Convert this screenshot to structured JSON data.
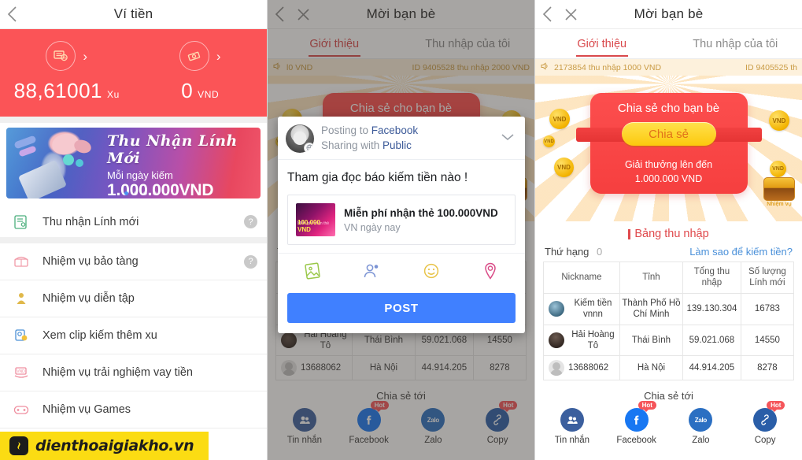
{
  "left": {
    "topbar": {
      "title": "Ví tiền",
      "back_icon": "chevron-left-icon"
    },
    "wallet": {
      "coin": {
        "amount": "88,61001",
        "unit": "Xu",
        "icon": "coin-stack-icon"
      },
      "cash": {
        "amount": "0",
        "unit": "VND",
        "icon": "money-note-icon"
      }
    },
    "banner": {
      "headline": "Thu Nhận Lính Mới",
      "subline": "Mỗi ngày kiếm",
      "amount": "1.000.000VND",
      "dots": 4,
      "active_dot": 0
    },
    "menu": [
      {
        "label": "Thu nhận Lính mới",
        "icon": "document-person-icon",
        "help": "?"
      },
      {
        "label": "Nhiệm vụ bảo tàng",
        "icon": "treasure-chest-icon",
        "help": "?"
      },
      {
        "label": "Nhiệm vụ diễn tập",
        "icon": "statue-icon",
        "help": ""
      },
      {
        "label": "Xem clip kiếm thêm xu",
        "icon": "video-coin-icon",
        "help": ""
      },
      {
        "label": "Nhiệm vụ trải nghiệm vay tiền",
        "icon": "hand-money-icon",
        "help": ""
      },
      {
        "label": "Nhiệm vụ Games",
        "icon": "gamepad-icon",
        "help": ""
      }
    ],
    "watermark": {
      "text": "dienthoaigiakho.vn",
      "logo_icon": "app-logo-icon"
    }
  },
  "invite": {
    "topbar": {
      "title": "Mời bạn bè",
      "back_icon": "chevron-left-icon",
      "close_icon": "close-icon"
    },
    "tabs": [
      {
        "label": "Giới thiệu",
        "active": true
      },
      {
        "label": "Thu nhập của tôi",
        "active": false
      }
    ],
    "marquee_mid": {
      "icon": "speaker-icon",
      "left": "l0 VND",
      "right": "ID 9405528 thu nhập 2000 VND"
    },
    "marquee_right": {
      "icon": "speaker-icon",
      "left": "2173854 thu nhập 1000 VND",
      "right": "ID 9405525 th"
    },
    "hero": {
      "card_title": "Chia sẻ cho bạn bè",
      "button_label": "Chia sẻ",
      "reward_line1": "Giải thưởng lên đến",
      "reward_line2": "1.000.000 VND",
      "coin_label": "VND",
      "chest_label": "Nhiệm vụ"
    },
    "board": {
      "title": "Bảng thu nhập",
      "rank_label": "Thứ hạng",
      "rank_value": "0",
      "help_link": "Làm sao để kiếm tiền?",
      "columns": [
        "Nickname",
        "Tỉnh",
        "Tổng thu nhập",
        "Số lượng Lính mới"
      ],
      "rows": [
        {
          "avatar": "a1",
          "nickname": "Kiếm tiền vnnn",
          "province": "Thành Phố Hồ Chí Minh",
          "income": "139.130.304",
          "recruits": "16783"
        },
        {
          "avatar": "a2",
          "nickname": "Hải Hoàng Tô",
          "province": "Thái Bình",
          "income": "59.021.068",
          "recruits": "14550"
        },
        {
          "avatar": "a3",
          "nickname": "13688062",
          "province": "Hà Nội",
          "income": "44.914.205",
          "recruits": "8278"
        }
      ]
    },
    "share": {
      "title": "Chia sẻ tới",
      "items": [
        {
          "label": "Tin nhắn",
          "icon": "message-people-icon",
          "badge": ""
        },
        {
          "label": "Facebook",
          "icon": "facebook-icon",
          "badge": "Hot"
        },
        {
          "label": "Zalo",
          "icon": "zalo-icon",
          "badge": ""
        },
        {
          "label": "Copy",
          "icon": "link-copy-icon",
          "badge": "Hot"
        }
      ]
    }
  },
  "fb_dialog": {
    "posting_prefix": "Posting to ",
    "posting_target": "Facebook",
    "sharing_prefix": "Sharing with ",
    "sharing_audience": "Public",
    "chevron_icon": "chevron-down-icon",
    "compose_text": "Tham gia đọc báo kiếm tiền nào !",
    "attachment": {
      "title": "Miễn phí nhận thẻ 100.000VND",
      "subtitle": "VN ngày nay",
      "thumb_line1": "Miễn phí nhận thẻ",
      "thumb_line2": "100.000 VND"
    },
    "tools": [
      {
        "icon": "photo-icon"
      },
      {
        "icon": "tag-person-icon"
      },
      {
        "icon": "emoji-icon"
      },
      {
        "icon": "location-pin-icon"
      }
    ],
    "post_label": "POST"
  },
  "colors": {
    "brand_red": "#fb5457",
    "card_red": "#fc4e4e",
    "accent_yellow": "#fcc90d",
    "facebook_blue": "#4080ff",
    "link_blue": "#4a90d9",
    "watermark_yellow": "#fbdc13",
    "tab_active": "#d9494c"
  }
}
